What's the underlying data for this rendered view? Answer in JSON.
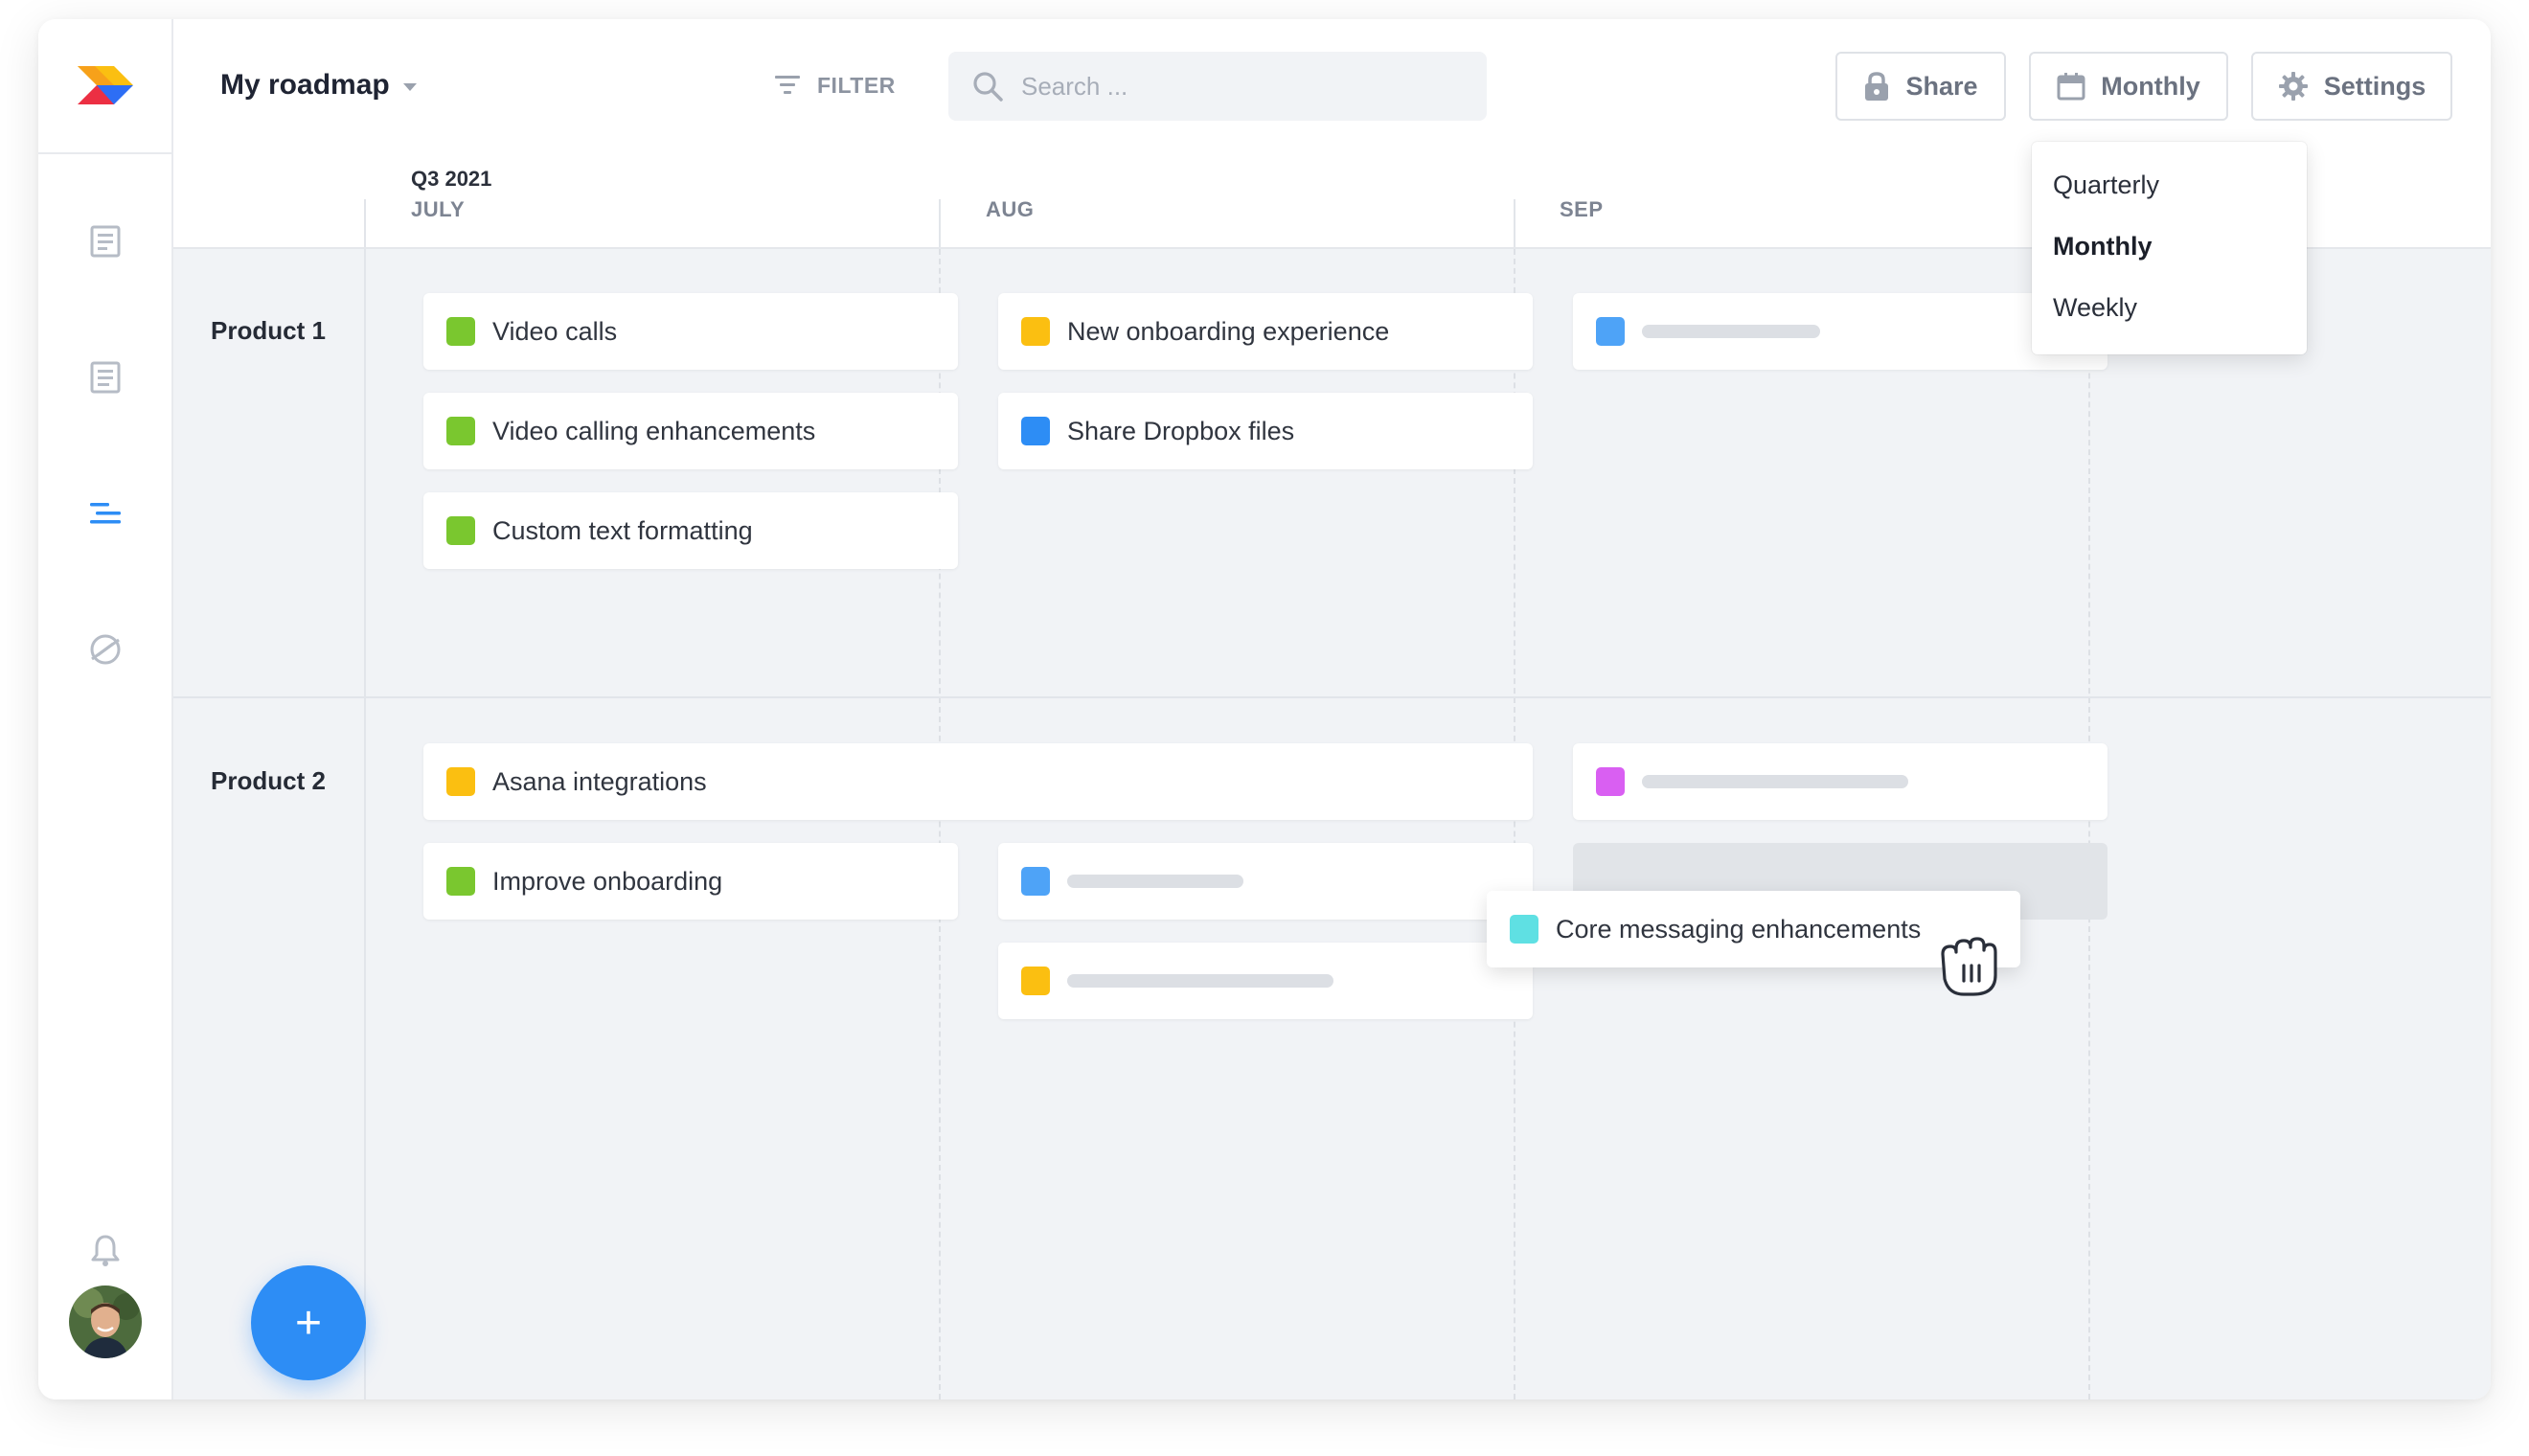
{
  "header": {
    "title": "My roadmap",
    "filter_label": "FILTER",
    "search_placeholder": "Search ...",
    "share_label": "Share",
    "view_label": "Monthly",
    "settings_label": "Settings"
  },
  "view_menu": {
    "options": [
      "Quarterly",
      "Monthly",
      "Weekly"
    ],
    "selected": "Monthly"
  },
  "timeline": {
    "quarter": "Q3 2021",
    "months": [
      "JULY",
      "AUG",
      "SEP"
    ]
  },
  "rows": [
    {
      "label": "Product 1",
      "cards": [
        {
          "text": "Video calls",
          "color": "#7ac72f"
        },
        {
          "text": "Video calling enhancements",
          "color": "#7ac72f"
        },
        {
          "text": "Custom text formatting",
          "color": "#7ac72f"
        },
        {
          "text": "New onboarding experience",
          "color": "#fbbf11"
        },
        {
          "text": "Share Dropbox files",
          "color": "#2d8df5"
        },
        {
          "text": "",
          "color": "#4ea3f7"
        }
      ]
    },
    {
      "label": "Product 2",
      "cards": [
        {
          "text": "Asana integrations",
          "color": "#fbbf11"
        },
        {
          "text": "Improve onboarding",
          "color": "#7ac72f"
        },
        {
          "text": "",
          "color": "#d95ff2"
        },
        {
          "text": "",
          "color": "#4ea3f7"
        },
        {
          "text": "",
          "color": "#fbbf11"
        }
      ]
    }
  ],
  "dragging_card": {
    "text": "Core messaging enhancements",
    "color": "#5fe0e3"
  },
  "fab_label": "+",
  "colors": {
    "accent": "#2d8df5",
    "green": "#7ac72f",
    "yellow": "#fbbf11",
    "purple": "#d95ff2",
    "teal": "#5fe0e3"
  }
}
